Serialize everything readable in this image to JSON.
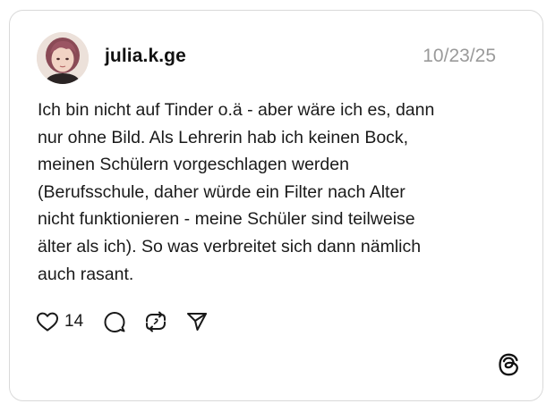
{
  "post": {
    "username": "julia.k.ge",
    "date": "10/23/25",
    "text": "Ich bin nicht auf Tinder o.ä - aber wäre ich es, dann nur ohne Bild. Als Lehrerin hab ich keinen Bock, meinen Schülern vorgeschlagen werden (Berufsschule, daher würde ein Filter nach Alter nicht funktionieren - meine Schüler sind teilweise älter als ich). So was verbreitet sich dann nämlich auch rasant.",
    "text_lines": [
      "Ich bin nicht auf Tinder o.ä - aber wäre ich es, dann",
      "nur ohne Bild. Als Lehrerin hab ich keinen Bock,",
      "meinen Schülern vorgeschlagen werden",
      "(Berufsschule, daher würde ein Filter nach Alter",
      "nicht funktionieren - meine Schüler sind teilweise",
      "älter als ich). So was verbreitet sich dann nämlich",
      "auch rasant."
    ],
    "like_count": "14"
  },
  "icons": {
    "like": "heart-icon",
    "reply": "comment-icon",
    "repost": "repost-icon",
    "share": "send-icon",
    "brand": "threads-logo-icon"
  },
  "colors": {
    "text": "#1a1a1a",
    "muted": "#9a9a9a",
    "border": "#d9d9d9"
  }
}
